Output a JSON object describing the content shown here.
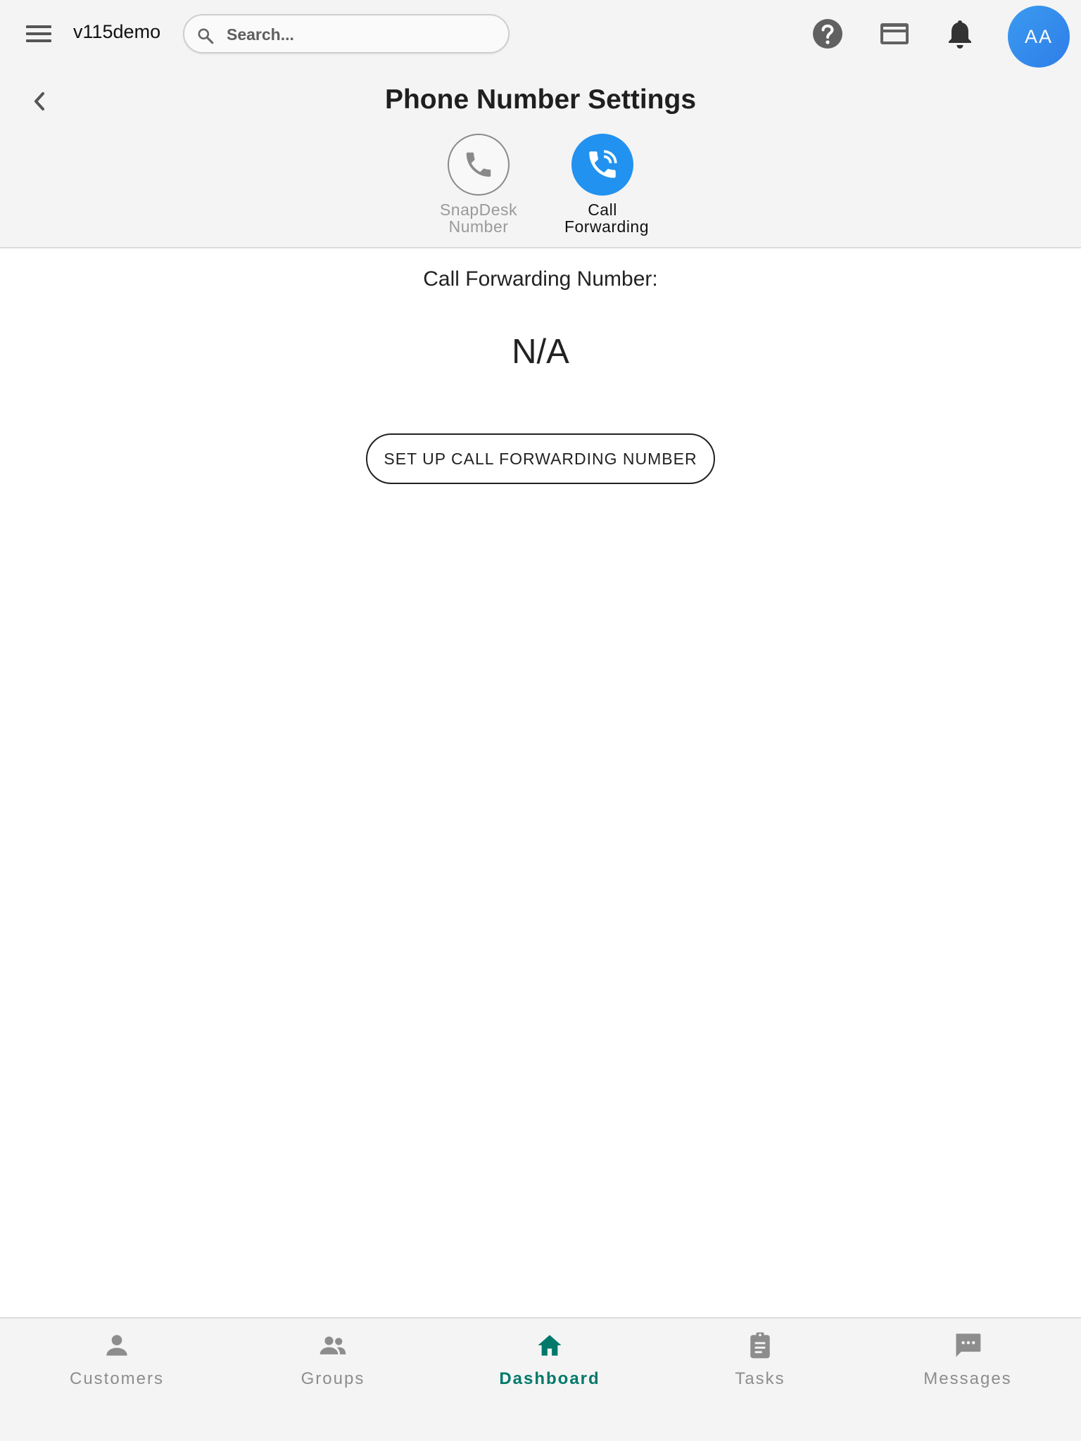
{
  "header": {
    "app_name": "v115demo",
    "search_placeholder": "Search...",
    "avatar_initials": "AA",
    "icons": [
      "menu-icon",
      "search-icon",
      "help-icon",
      "credit-card-icon",
      "bell-icon"
    ]
  },
  "page": {
    "title": "Phone Number Settings"
  },
  "tabs": [
    {
      "label_line1": "SnapDesk",
      "label_line2": "Number",
      "icon": "phone-icon",
      "active": false
    },
    {
      "label_line1": "Call",
      "label_line2": "Forwarding",
      "icon": "phone-forward-icon",
      "active": true
    }
  ],
  "call_forwarding": {
    "label": "Call Forwarding Number:",
    "value": "N/A",
    "setup_button": "SET UP CALL FORWARDING NUMBER"
  },
  "bottom_nav": [
    {
      "label": "Customers",
      "icon": "person-icon",
      "active": false
    },
    {
      "label": "Groups",
      "icon": "people-icon",
      "active": false
    },
    {
      "label": "Dashboard",
      "icon": "home-icon",
      "active": true
    },
    {
      "label": "Tasks",
      "icon": "clipboard-icon",
      "active": false
    },
    {
      "label": "Messages",
      "icon": "chat-icon",
      "active": false
    }
  ],
  "colors": {
    "accent": "#2192f0",
    "active_nav": "#00796b",
    "header_bg": "#f4f4f4",
    "avatar": "#3a8df0"
  }
}
